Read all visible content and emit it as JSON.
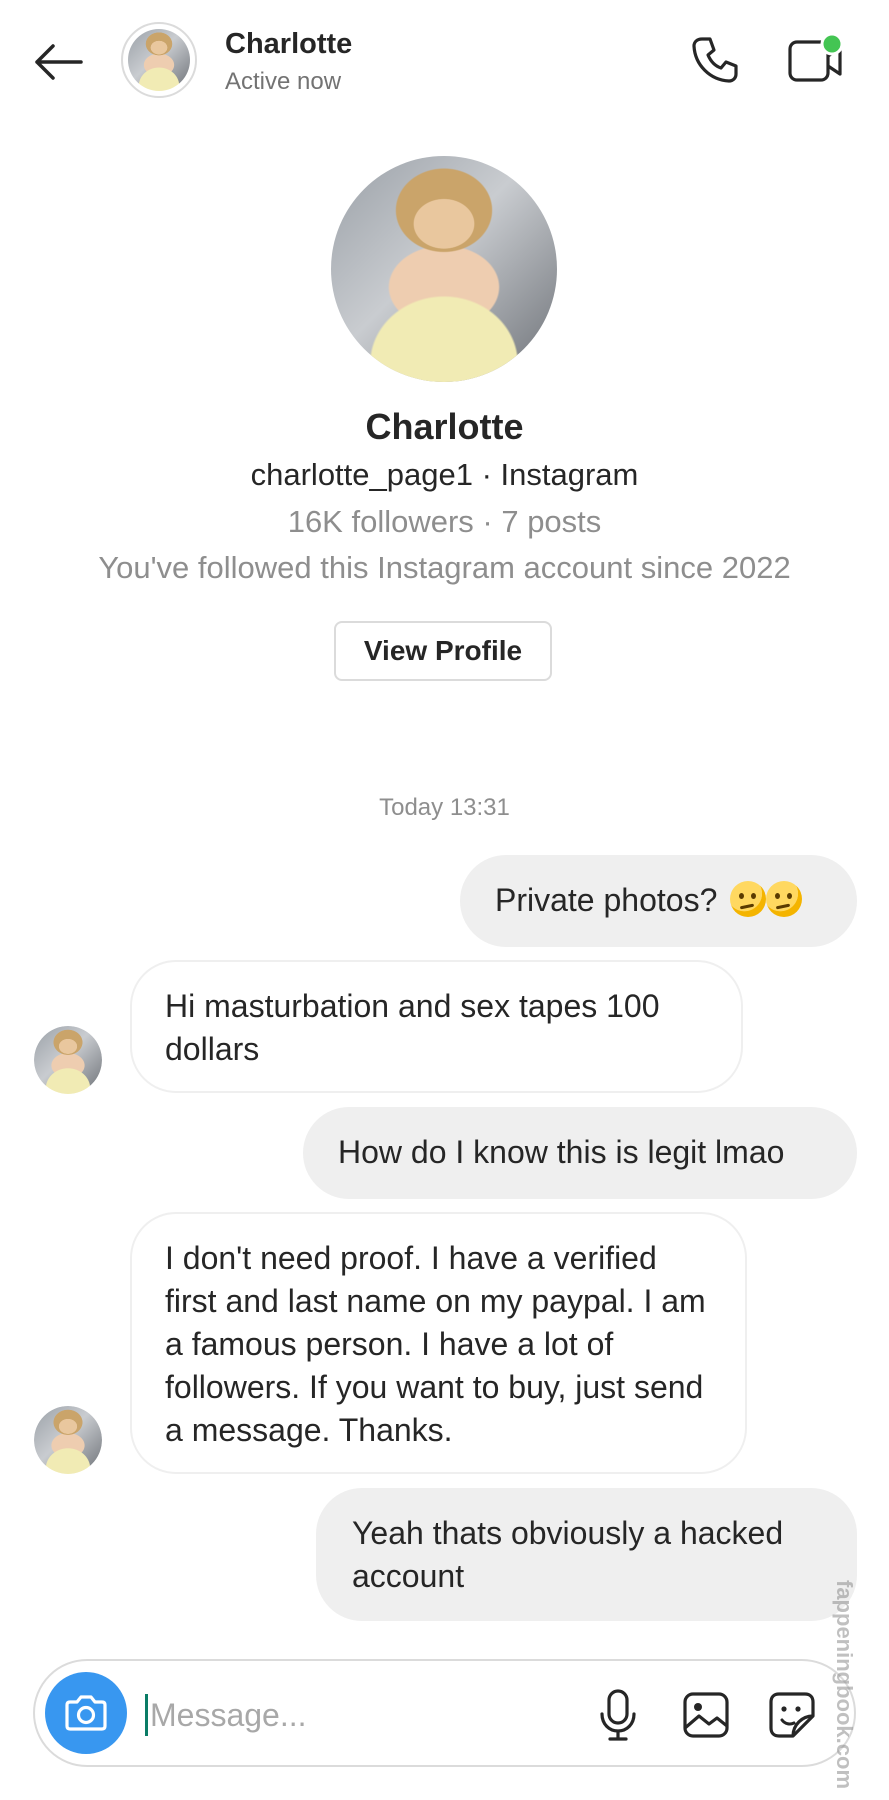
{
  "header": {
    "name": "Charlotte",
    "status": "Active now",
    "icons": {
      "back": "arrow-left-icon",
      "call": "phone-icon",
      "video": "video-camera-icon",
      "online_dot_color": "#44c553"
    }
  },
  "profile": {
    "name": "Charlotte",
    "handle_line": "charlotte_page1 · Instagram",
    "stats_line": "16K followers · 7 posts",
    "since_line": "You've followed this Instagram account since 2022",
    "view_profile_label": "View Profile"
  },
  "chat": {
    "timestamp": "Today 13:31",
    "messages": [
      {
        "direction": "outgoing",
        "text": "Private photos?",
        "emoji": [
          "thinking-face-emoji",
          "thinking-face-emoji"
        ]
      },
      {
        "direction": "incoming",
        "text": "Hi masturbation and sex tapes 100 dollars"
      },
      {
        "direction": "outgoing",
        "text": "How do I know this is legit lmao"
      },
      {
        "direction": "incoming",
        "text": "I don't need proof. I have a verified first and last name on my paypal. I am a famous person. I have a lot of followers. If you want to buy, just send a message. Thanks."
      },
      {
        "direction": "outgoing",
        "text": "Yeah thats obviously a hacked account"
      }
    ]
  },
  "composer": {
    "placeholder": "Message...",
    "value": "",
    "icons": [
      "camera-icon",
      "microphone-icon",
      "gallery-icon",
      "sticker-icon"
    ],
    "camera_button_color": "#3897f0"
  },
  "watermark": "fappeningbook.com",
  "colors": {
    "outgoing_bubble": "#efefef",
    "secondary_text": "#8e8e8e"
  }
}
